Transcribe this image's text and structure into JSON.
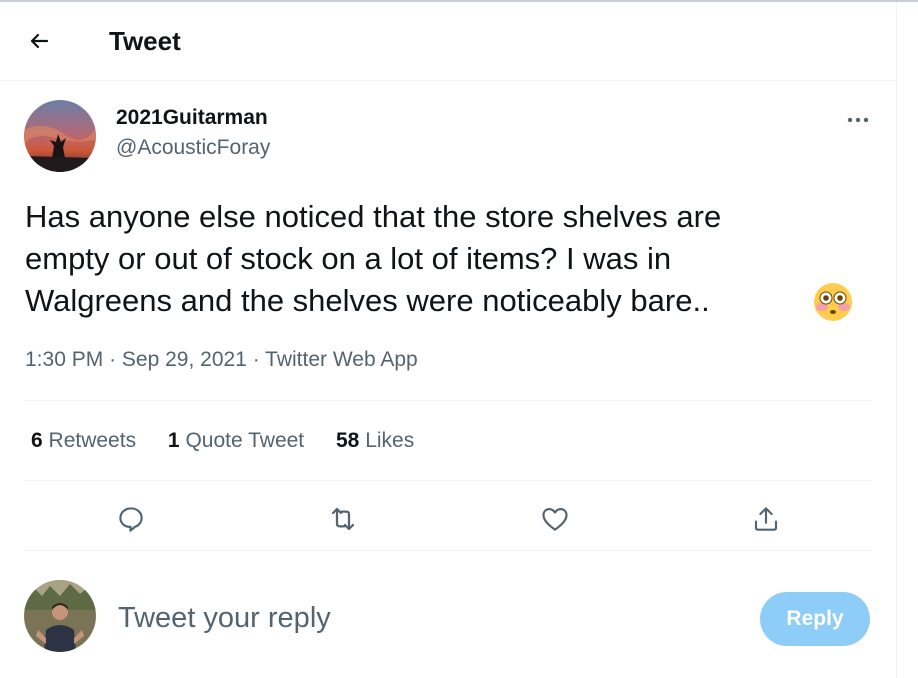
{
  "header": {
    "title": "Tweet",
    "back_icon": "arrow-left-icon"
  },
  "tweet": {
    "author": {
      "display_name": "2021Guitarman",
      "handle": "@AcousticForay",
      "avatar": "sunset-tree-avatar"
    },
    "text_lines": [
      "Has anyone else noticed that the store shelves are",
      "empty or out of stock on a lot of items?  I was in",
      "Walgreens and the shelves were noticeably bare.."
    ],
    "emoji": "flushed-face-emoji",
    "time": "1:30 PM",
    "date": "Sep 29, 2021",
    "source": "Twitter Web App",
    "meta_separator": "·",
    "more_icon": "more-dots-icon"
  },
  "stats": [
    {
      "count": "6",
      "label": "Retweets"
    },
    {
      "count": "1",
      "label": "Quote Tweet"
    },
    {
      "count": "58",
      "label": "Likes"
    }
  ],
  "actions": [
    {
      "name": "reply",
      "icon": "comment-icon"
    },
    {
      "name": "retweet",
      "icon": "retweet-icon"
    },
    {
      "name": "like",
      "icon": "heart-icon"
    },
    {
      "name": "share",
      "icon": "share-icon"
    }
  ],
  "reply": {
    "placeholder": "Tweet your reply",
    "button_label": "Reply",
    "avatar": "person-outdoor-avatar"
  },
  "colors": {
    "text": "#0f1419",
    "secondary": "#536471",
    "divider": "#eff3f4",
    "reply_button": "#8ecdf8",
    "icon": "#536471"
  }
}
